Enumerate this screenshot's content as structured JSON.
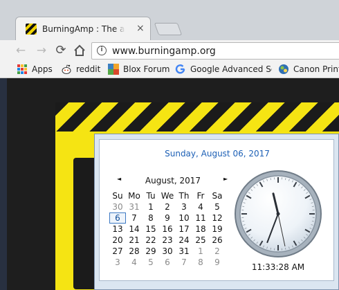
{
  "browser": {
    "tab": {
      "title": "BurningAmp : The annual",
      "close": "×",
      "favicon": "hazard-stripe-icon"
    },
    "nav": {
      "back": "←",
      "forward": "→",
      "reload": "⟳",
      "home": "home-icon"
    },
    "address": {
      "url": "www.burningamp.org",
      "info": "i"
    },
    "bookmarks": [
      {
        "label": "Apps",
        "icon": "apps-grid-icon"
      },
      {
        "label": "reddit",
        "icon": "reddit-icon"
      },
      {
        "label": "Blox Forum",
        "icon": "blox-icon"
      },
      {
        "label": "Google Advanced Search",
        "icon": "google-icon"
      },
      {
        "label": "Canon Printer",
        "icon": "canon-icon"
      }
    ]
  },
  "colors": {
    "hazard_yellow": "#f5e413",
    "hazard_black": "#1b1b1b",
    "date_header_blue": "#1c5fb5"
  },
  "clock": {
    "date_header": "Sunday, August 06, 2017",
    "month_label": "August, 2017",
    "prev": "◄",
    "next": "►",
    "weekdays": [
      "Su",
      "Mo",
      "Tu",
      "We",
      "Th",
      "Fr",
      "Sa"
    ],
    "weeks": [
      [
        "30",
        "31",
        "1",
        "2",
        "3",
        "4",
        "5"
      ],
      [
        "6",
        "7",
        "8",
        "9",
        "10",
        "11",
        "12"
      ],
      [
        "13",
        "14",
        "15",
        "16",
        "17",
        "18",
        "19"
      ],
      [
        "20",
        "21",
        "22",
        "23",
        "24",
        "25",
        "26"
      ],
      [
        "27",
        "28",
        "29",
        "30",
        "31",
        "1",
        "2"
      ],
      [
        "3",
        "4",
        "5",
        "6",
        "7",
        "8",
        "9"
      ]
    ],
    "time": "11:33:28 AM",
    "hands": {
      "hour": 11,
      "minute": 33,
      "second": 28
    }
  }
}
